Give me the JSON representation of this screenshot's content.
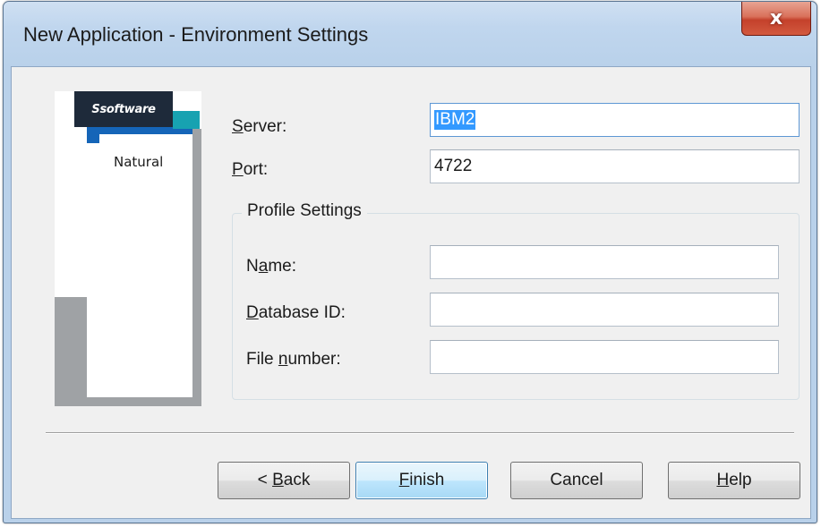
{
  "window": {
    "title": "New Application - Environment Settings",
    "close_glyph": "x"
  },
  "logo": {
    "brand": "software",
    "brand_mark": "S",
    "product": "Natural"
  },
  "form": {
    "server": {
      "label_accel": "S",
      "label_rest": "erver:",
      "value": "IBM2"
    },
    "port": {
      "label_accel": "P",
      "label_rest": "ort:",
      "value": "4722"
    },
    "profile_group": {
      "title": "Profile Settings",
      "name": {
        "label_pre": "N",
        "label_accel": "a",
        "label_rest": "me:",
        "value": ""
      },
      "database_id": {
        "label_accel": "D",
        "label_rest": "atabase ID:",
        "value": ""
      },
      "file_number": {
        "label_pre": "File ",
        "label_accel": "n",
        "label_rest": "umber:",
        "value": ""
      }
    }
  },
  "buttons": {
    "back": {
      "prefix": "< ",
      "accel": "B",
      "rest": "ack"
    },
    "finish": {
      "accel": "F",
      "rest": "inish"
    },
    "cancel": {
      "label": "Cancel"
    },
    "help": {
      "accel": "H",
      "rest": "elp"
    }
  },
  "colors": {
    "selection": "#3399ff",
    "close_button": "#c4412b",
    "brand_dark": "#1e2a3a",
    "brand_blue": "#1565b8",
    "brand_teal": "#17a2b1"
  }
}
